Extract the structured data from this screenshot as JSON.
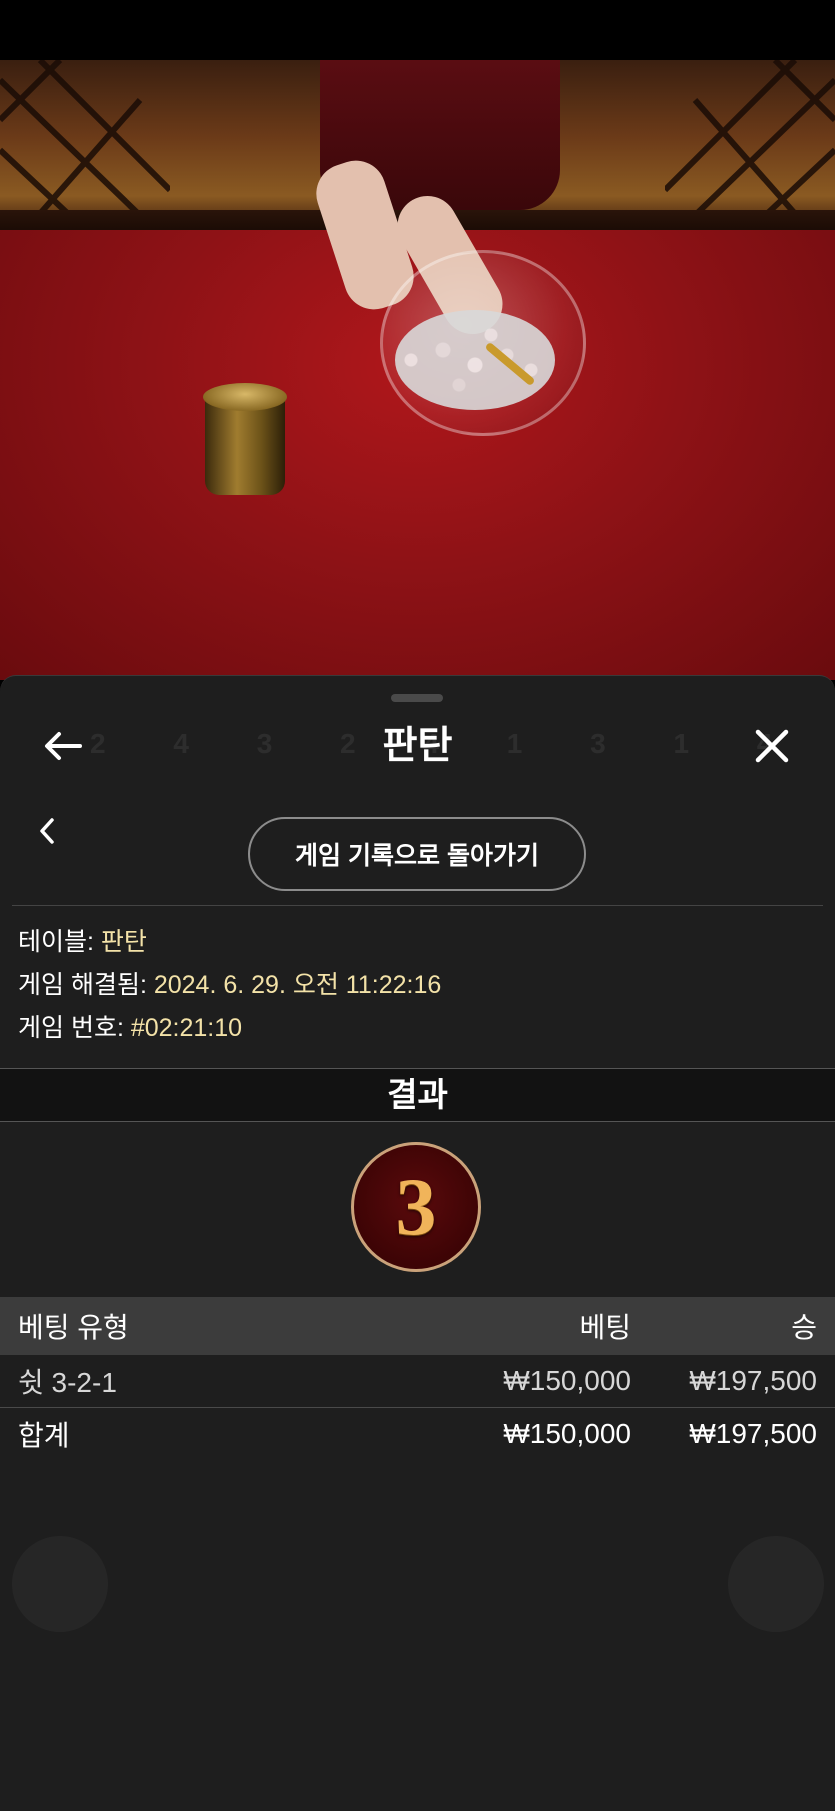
{
  "sheet": {
    "title": "판탄",
    "back_to_history": "게임 기록으로 돌아가기",
    "info": {
      "table_label": "테이블: ",
      "table_value": "판탄",
      "resolved_label": "게임 해결됨: ",
      "resolved_value": "2024. 6. 29. 오전 11:22:16",
      "game_no_label": "게임 번호: ",
      "game_no_value": "#02:21:10"
    },
    "result_label": "결과",
    "result_value": "3",
    "bets": {
      "headers": {
        "type": "베팅 유형",
        "bet": "베팅",
        "win": "승"
      },
      "rows": [
        {
          "type": "쉿 3-2-1",
          "bet": "₩150,000",
          "win": "₩197,500"
        }
      ],
      "total": {
        "label": "합계",
        "bet": "₩150,000",
        "win": "₩197,500"
      }
    }
  },
  "icons": {
    "back": "arrow-left-icon",
    "close": "close-icon",
    "chevron": "chevron-left-icon"
  }
}
